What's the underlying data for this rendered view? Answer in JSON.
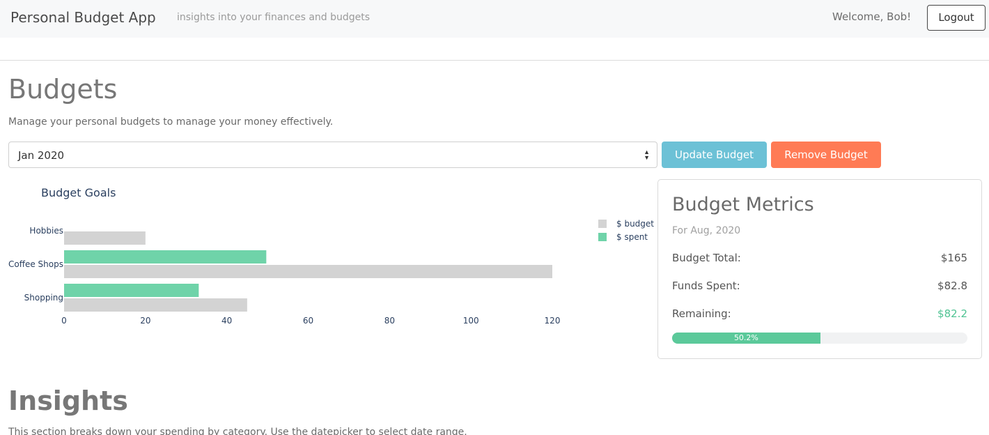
{
  "navbar": {
    "brand": "Personal Budget App",
    "tagline": "insights into your finances and budgets",
    "welcome": "Welcome, Bob!",
    "logout_label": "Logout"
  },
  "budgets": {
    "title": "Budgets",
    "description": "Manage your personal budgets to manage your money effectively.",
    "selected_month": "Jan 2020",
    "update_label": "Update Budget",
    "remove_label": "Remove Budget"
  },
  "chart_data": {
    "type": "bar",
    "orientation": "horizontal",
    "title": "Budget Goals",
    "categories": [
      "Hobbies",
      "Coffee Shops",
      "Shopping"
    ],
    "series": [
      {
        "name": "$ budget",
        "values": [
          20,
          120,
          45
        ],
        "color": "#d3d3d3"
      },
      {
        "name": "$ spent",
        "values": [
          0,
          49.7,
          33.1
        ],
        "color": "#6fd3a9"
      }
    ],
    "xticks": [
      0,
      20,
      40,
      60,
      80,
      100,
      120
    ],
    "xlim": [
      0,
      120
    ],
    "legend_position": "top-right",
    "grid": false
  },
  "metrics": {
    "title": "Budget Metrics",
    "subtitle": "For Aug, 2020",
    "rows": [
      {
        "label": "Budget Total:",
        "value": "$165"
      },
      {
        "label": "Funds Spent:",
        "value": "$82.8"
      },
      {
        "label": "Remaining:",
        "value": "$82.2"
      }
    ],
    "progress_percent": 50.2,
    "progress_label": "50.2%",
    "accent_color": "#5bc99a"
  },
  "insights": {
    "title": "Insights",
    "description": "This section breaks down your spending by category. Use the datepicker to select date range."
  }
}
